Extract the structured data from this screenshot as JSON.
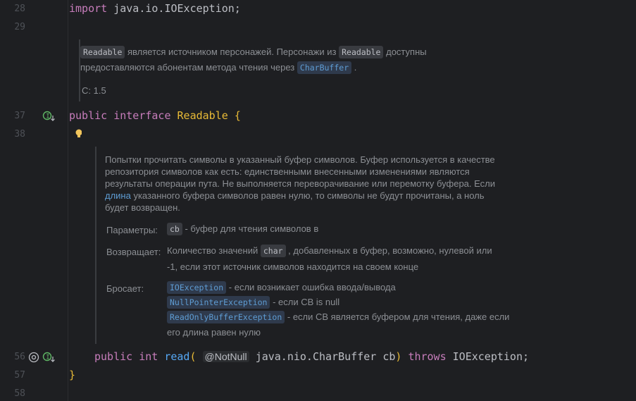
{
  "gutter": {
    "lines": [
      "28",
      "29",
      "37",
      "38",
      "56",
      "57",
      "58"
    ]
  },
  "code": {
    "line28": {
      "kw": "import",
      "rest": " java.io.IOException;"
    },
    "line37": {
      "kw1": "public",
      "kw2": "interface",
      "name": "Readable",
      "brace": "{"
    },
    "line56": {
      "kw1": "public",
      "kw2": "int",
      "method": "read",
      "paren": "(",
      "ann": "@NotNull",
      "type": "java.nio.CharBuffer",
      "param": "cb",
      "close": ")",
      "throws": "throws",
      "exc": "IOException",
      "semi": ";"
    },
    "line57": {
      "brace": "}"
    }
  },
  "doc1": {
    "chip1": "Readable",
    "t1": "является источником персонажей. Персонажи из",
    "chip2": "Readable",
    "t2": "доступны",
    "t3": "предоставляются абонентам метода чтения через",
    "chip3": "CharBuffer",
    "t4": ".",
    "since": "С: 1.5"
  },
  "doc2": {
    "p1": "Попытки прочитать символы в указанный буфер символов. Буфер используется в качестве",
    "p2": "репозитория символов как есть: единственными внесенными изменениями являются",
    "p3": "результаты операции пута. Не выполняется переворачивание или перемотку буфера. Если",
    "p4link": "длина",
    "p4": " указанного буфера символов равен нулю, то символы не будут прочитаны, а ноль",
    "p5": "будет возвращен.",
    "params_label": "Параметры:",
    "param_chip": "cb",
    "param_text": "- буфер для чтения символов в",
    "returns_label": "Возвращает:",
    "returns_t1": "Количество значений",
    "returns_chip": "char",
    "returns_t2": ", добавленных в буфер, возможно, нулевой или",
    "returns_t3": "-1, если этот источник символов находится на своем конце",
    "throws_label": "Бросает:",
    "th1_chip": "IOException",
    "th1_text": "- если возникает ошибка ввода/вывода",
    "th2_chip": "NullPointerException",
    "th2_text": "- если СВ is null",
    "th3_chip": "ReadOnlyBufferException",
    "th3_text": "- если СВ является буфером для чтения, даже если",
    "th3_text2": "его длина равен нулю"
  },
  "colors": {
    "background": "#1e1f22",
    "keyword": "#c77dbb",
    "method": "#56a8f5",
    "brace": "#e8ba36",
    "link": "#5e9cd3"
  },
  "icons": {
    "implemented": "implemented-icon",
    "override": "at-sign-icon",
    "bulb": "lightbulb-icon"
  }
}
